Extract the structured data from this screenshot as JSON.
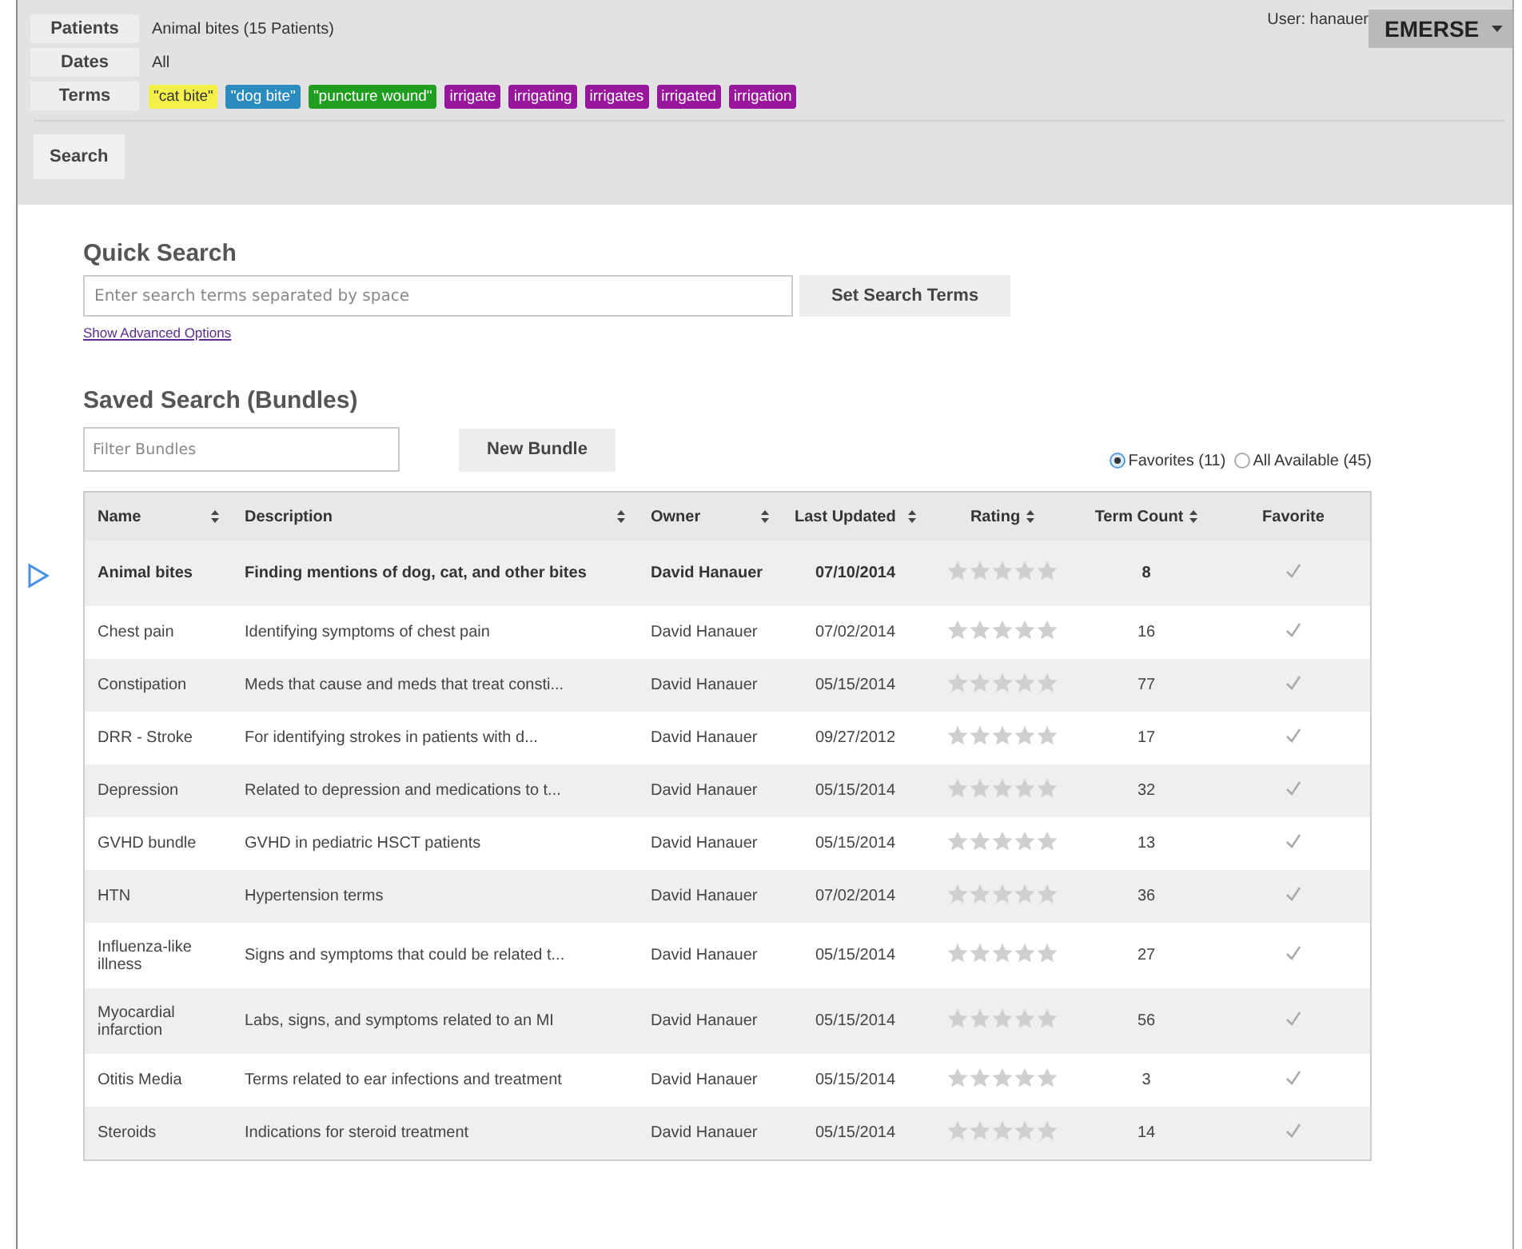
{
  "header": {
    "filters": [
      {
        "label": "Patients",
        "value": "Animal bites (15 Patients)"
      },
      {
        "label": "Dates",
        "value": "All"
      }
    ],
    "terms_label": "Terms",
    "terms": [
      {
        "text": "\"cat bite\"",
        "color": "#f3f04a"
      },
      {
        "text": "\"dog bite\"",
        "color": "#2a8bbf"
      },
      {
        "text": "\"puncture wound\"",
        "color": "#1f9e1f"
      },
      {
        "text": "irrigate",
        "color": "#98169b"
      },
      {
        "text": "irrigating",
        "color": "#98169b"
      },
      {
        "text": "irrigates",
        "color": "#98169b"
      },
      {
        "text": "irrigated",
        "color": "#98169b"
      },
      {
        "text": "irrigation",
        "color": "#98169b"
      }
    ],
    "search_button": "Search",
    "user": "User: hanauer",
    "app_menu": "EMERSE"
  },
  "quick_search": {
    "title": "Quick Search",
    "placeholder": "Enter search terms separated by space",
    "button": "Set Search Terms",
    "link": "Show Advanced Options"
  },
  "bundles": {
    "title": "Saved Search (Bundles)",
    "filter_placeholder": "Filter Bundles",
    "new_button": "New Bundle",
    "scope": [
      {
        "label": "Favorites (11)",
        "selected": true
      },
      {
        "label": "All Available (45)",
        "selected": false
      }
    ],
    "columns": [
      {
        "label": "Name",
        "sortable": true
      },
      {
        "label": "Description",
        "sortable": true
      },
      {
        "label": "Owner",
        "sortable": true
      },
      {
        "label": "Last Updated",
        "sortable": true
      },
      {
        "label": "Rating",
        "sortable": true
      },
      {
        "label": "Term Count",
        "sortable": true
      },
      {
        "label": "Favorite",
        "sortable": false
      }
    ],
    "rows": [
      {
        "name": "Animal bites",
        "description": "Finding mentions of dog, cat, and other bites",
        "owner": "David Hanauer",
        "updated": "07/10/2014",
        "stars": 0,
        "count": "8",
        "favorite": true,
        "selected": true
      },
      {
        "name": "Chest pain",
        "description": "Identifying symptoms of chest pain",
        "owner": "David Hanauer",
        "updated": "07/02/2014",
        "stars": 0,
        "count": "16",
        "favorite": true,
        "selected": false
      },
      {
        "name": "Constipation",
        "description": "Meds that cause and meds that treat consti...",
        "owner": "David Hanauer",
        "updated": "05/15/2014",
        "stars": 0,
        "count": "77",
        "favorite": true,
        "selected": false
      },
      {
        "name": "DRR - Stroke",
        "description": "For identifying strokes in patients with d...",
        "owner": "David Hanauer",
        "updated": "09/27/2012",
        "stars": 0,
        "count": "17",
        "favorite": true,
        "selected": false
      },
      {
        "name": "Depression",
        "description": "Related to depression and medications to t...",
        "owner": "David Hanauer",
        "updated": "05/15/2014",
        "stars": 0,
        "count": "32",
        "favorite": true,
        "selected": false
      },
      {
        "name": "GVHD bundle",
        "description": "GVHD in pediatric HSCT patients",
        "owner": "David Hanauer",
        "updated": "05/15/2014",
        "stars": 0,
        "count": "13",
        "favorite": true,
        "selected": false
      },
      {
        "name": "HTN",
        "description": "Hypertension terms",
        "owner": "David Hanauer",
        "updated": "07/02/2014",
        "stars": 0,
        "count": "36",
        "favorite": true,
        "selected": false
      },
      {
        "name": "Influenza-like illness",
        "description": "Signs and symptoms that could be related t...",
        "owner": "David Hanauer",
        "updated": "05/15/2014",
        "stars": 0,
        "count": "27",
        "favorite": true,
        "selected": false
      },
      {
        "name": "Myocardial infarction",
        "description": "Labs, signs, and symptoms related to an MI",
        "owner": "David Hanauer",
        "updated": "05/15/2014",
        "stars": 0,
        "count": "56",
        "favorite": true,
        "selected": false
      },
      {
        "name": "Otitis Media",
        "description": "Terms related to ear infections and treatment",
        "owner": "David Hanauer",
        "updated": "05/15/2014",
        "stars": 0,
        "count": "3",
        "favorite": true,
        "selected": false
      },
      {
        "name": "Steroids",
        "description": "Indications for steroid treatment",
        "owner": "David Hanauer",
        "updated": "05/15/2014",
        "stars": 0,
        "count": "14",
        "favorite": true,
        "selected": false
      }
    ]
  }
}
